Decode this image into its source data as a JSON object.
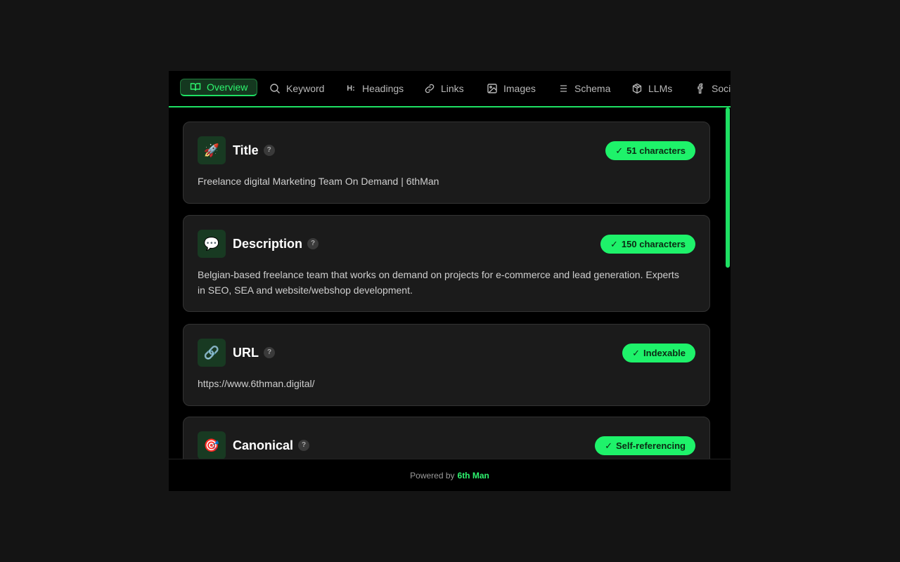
{
  "tabs": [
    {
      "label": "Overview",
      "icon": "book-open-icon",
      "active": true
    },
    {
      "label": "Keyword",
      "icon": "search-icon",
      "active": false
    },
    {
      "label": "Headings",
      "icon": "heading-icon",
      "glyph": "H:",
      "active": false
    },
    {
      "label": "Links",
      "icon": "link-icon",
      "active": false
    },
    {
      "label": "Images",
      "icon": "image-icon",
      "active": false
    },
    {
      "label": "Schema",
      "icon": "list-icon",
      "active": false
    },
    {
      "label": "LLMs",
      "icon": "cube-icon",
      "active": false
    },
    {
      "label": "Social",
      "icon": "facebook-icon",
      "active": false
    }
  ],
  "cards": [
    {
      "title": "Title",
      "icon": "rocket-icon",
      "emoji": "🚀",
      "help": "?",
      "badge": "51 characters",
      "check": "✓",
      "body": "Freelance digital Marketing Team On Demand | 6thMan"
    },
    {
      "title": "Description",
      "icon": "speech-bubble-icon",
      "emoji": "💬",
      "help": "?",
      "badge": "150 characters",
      "check": "✓",
      "body": "Belgian-based freelance team that works on demand on projects for e-commerce and lead generation. Experts in SEO, SEA and website/webshop development."
    },
    {
      "title": "URL",
      "icon": "chain-link-icon",
      "emoji": "🔗",
      "help": "?",
      "badge": "Indexable",
      "check": "✓",
      "body": "https://www.6thman.digital/"
    },
    {
      "title": "Canonical",
      "icon": "target-icon",
      "emoji": "🎯",
      "help": "?",
      "badge": "Self-referencing",
      "check": "✓",
      "body": ""
    }
  ],
  "footer": {
    "prefix": "Powered by",
    "brand": "6th Man"
  },
  "colors": {
    "accent": "#1ef26a",
    "background": "#000000",
    "card": "#1b1b1b"
  }
}
